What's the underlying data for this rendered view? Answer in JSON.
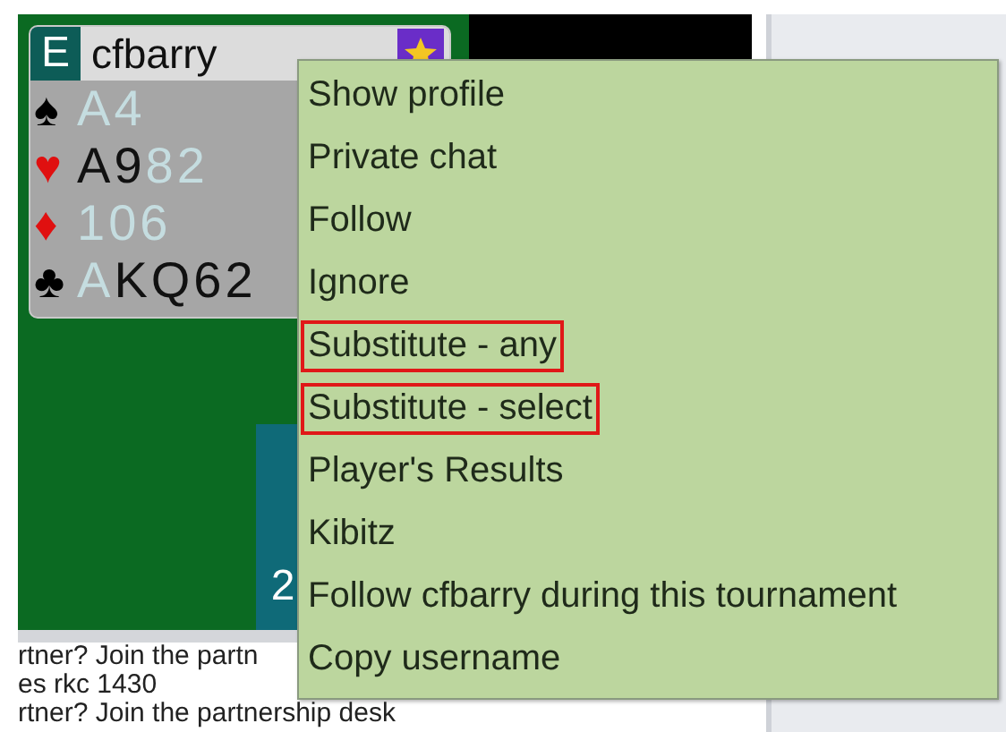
{
  "player": {
    "seat": "E",
    "name": "cfbarry",
    "suits": [
      {
        "kind": "spades",
        "symbol": "♠",
        "cards": [
          {
            "rank": "A",
            "played": true
          },
          {
            "rank": "4",
            "played": true
          }
        ]
      },
      {
        "kind": "hearts",
        "symbol": "♥",
        "cards": [
          {
            "rank": "A",
            "played": false
          },
          {
            "rank": "9",
            "played": false
          },
          {
            "rank": "8",
            "played": true
          },
          {
            "rank": "2",
            "played": true
          }
        ]
      },
      {
        "kind": "diamonds",
        "symbol": "♦",
        "cards": [
          {
            "rank": "10",
            "played": true
          },
          {
            "rank": "6",
            "played": true
          }
        ]
      },
      {
        "kind": "clubs",
        "symbol": "♣",
        "cards": [
          {
            "rank": "A",
            "played": true
          },
          {
            "rank": "K",
            "played": false
          },
          {
            "rank": "Q",
            "played": false
          },
          {
            "rank": "6",
            "played": false
          },
          {
            "rank": "2",
            "played": false
          }
        ]
      }
    ]
  },
  "table_marker": "2",
  "chat": [
    "rtner? Join the partn",
    "es rkc 1430",
    "rtner? Join the partnership desk"
  ],
  "menu": [
    {
      "label": "Show profile",
      "highlighted": false
    },
    {
      "label": "Private chat",
      "highlighted": false
    },
    {
      "label": "Follow",
      "highlighted": false
    },
    {
      "label": "Ignore",
      "highlighted": false
    },
    {
      "label": "Substitute - any",
      "highlighted": true
    },
    {
      "label": "Substitute - select",
      "highlighted": true
    },
    {
      "label": "Player's Results",
      "highlighted": false
    },
    {
      "label": "Kibitz",
      "highlighted": false
    },
    {
      "label": "Follow cfbarry during this tournament",
      "highlighted": false
    },
    {
      "label": "Copy username",
      "highlighted": false
    }
  ]
}
